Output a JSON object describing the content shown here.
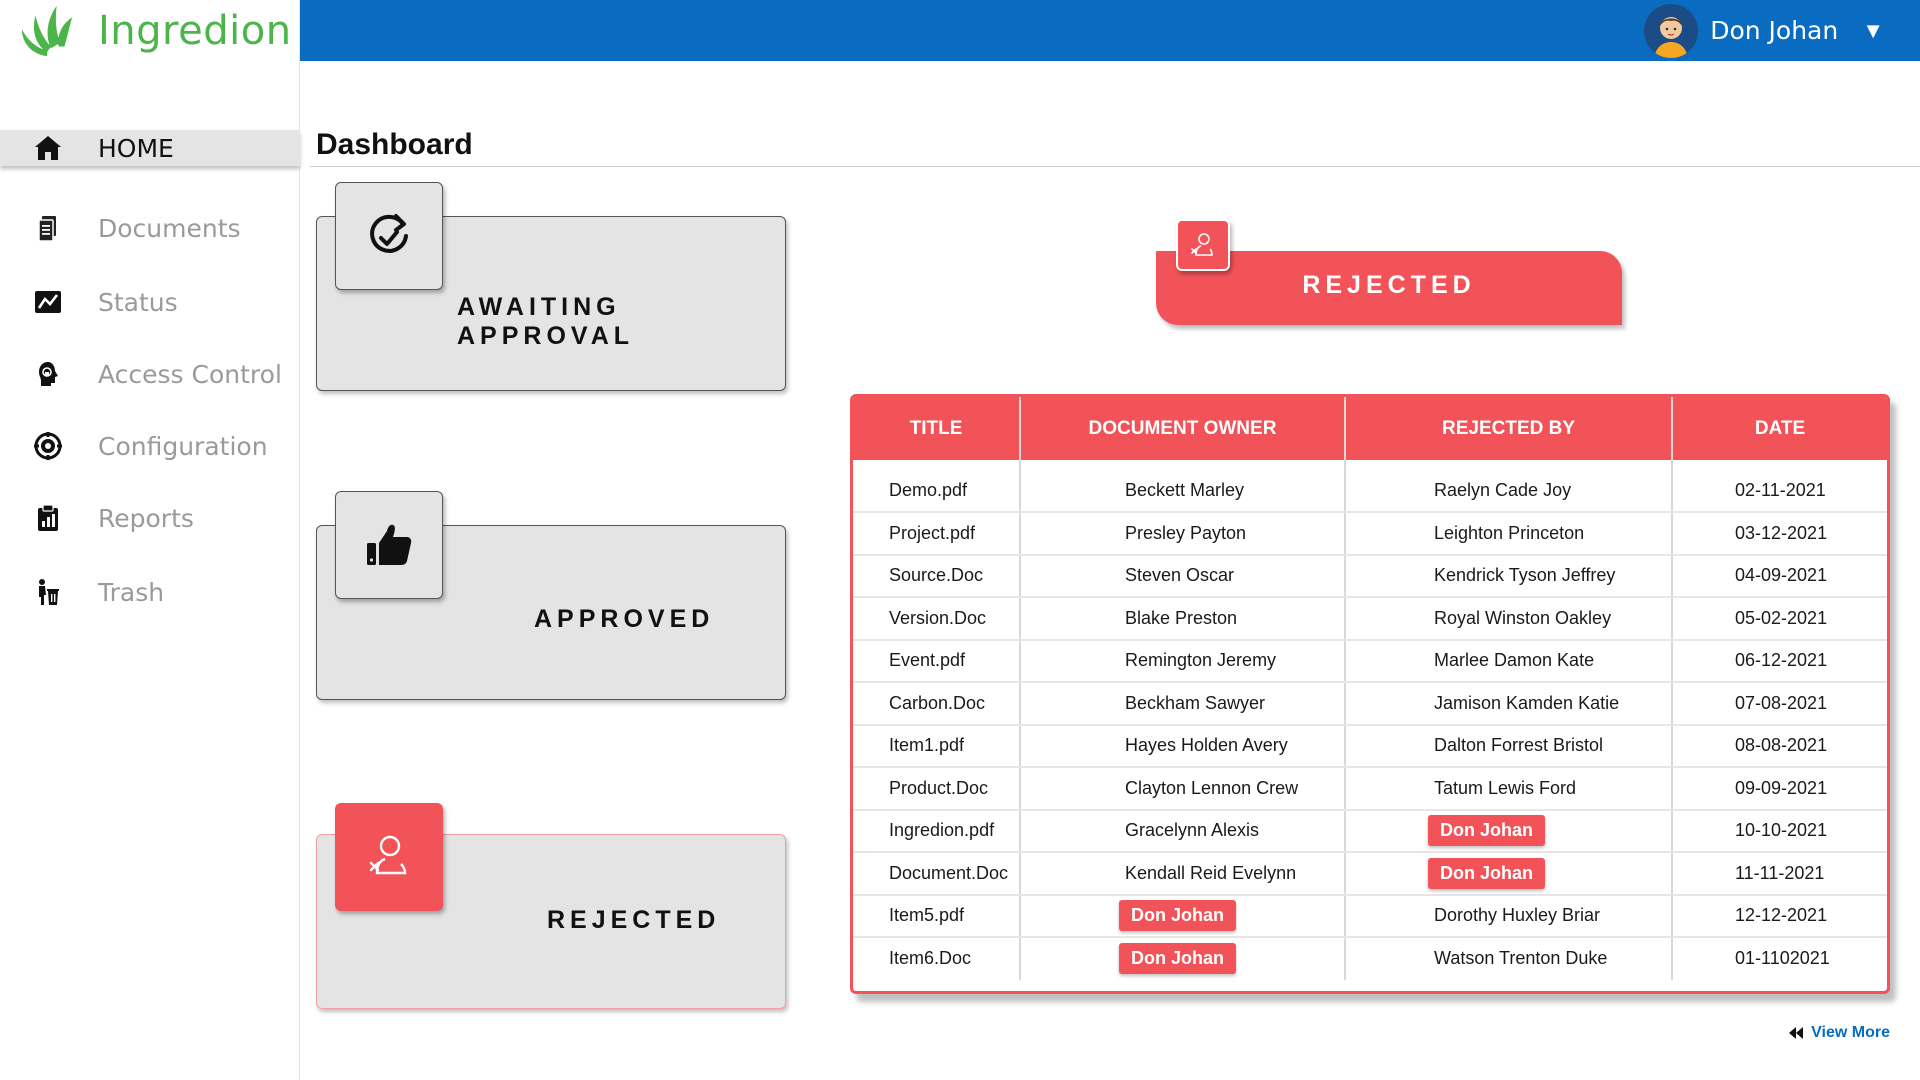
{
  "brand": {
    "name": "Ingredion",
    "color": "#4bb54a"
  },
  "colors": {
    "topbar": "#0a6cc1",
    "accent": "#f25358",
    "card": "#e4e4e4"
  },
  "user": {
    "name": "Don Johan",
    "caret": "▼"
  },
  "sidebar": {
    "items": [
      {
        "label": "HOME",
        "icon": "home-icon",
        "active": true
      },
      {
        "label": "Documents",
        "icon": "documents-icon"
      },
      {
        "label": "Status",
        "icon": "status-chart-icon"
      },
      {
        "label": "Access Control",
        "icon": "access-control-icon"
      },
      {
        "label": "Configuration",
        "icon": "configuration-icon"
      },
      {
        "label": "Reports",
        "icon": "reports-icon"
      },
      {
        "label": "Trash",
        "icon": "trash-icon"
      }
    ]
  },
  "page": {
    "title": "Dashboard"
  },
  "cards": {
    "awaiting": {
      "label": "AWAITING APPROVAL",
      "icon": "refresh-check-icon"
    },
    "approved": {
      "label": "APPROVED",
      "icon": "thumbs-up-icon"
    },
    "rejected": {
      "label": "REJECTED",
      "icon": "user-rejected-icon"
    }
  },
  "banner": {
    "label": "REJECTED",
    "icon": "user-rejected-icon"
  },
  "table": {
    "columns": [
      "TITLE",
      "DOCUMENT OWNER",
      "REJECTED BY",
      "DATE"
    ],
    "rows": [
      {
        "title": "Demo.pdf",
        "owner": "Beckett Marley",
        "rejected_by": "Raelyn Cade Joy",
        "date": "02-11-2021",
        "owner_highlight": false,
        "rejected_highlight": false
      },
      {
        "title": "Project.pdf",
        "owner": "Presley Payton",
        "rejected_by": "Leighton Princeton",
        "date": "03-12-2021",
        "owner_highlight": false,
        "rejected_highlight": false
      },
      {
        "title": "Source.Doc",
        "owner": "Steven Oscar",
        "rejected_by": "Kendrick Tyson Jeffrey",
        "date": "04-09-2021",
        "owner_highlight": false,
        "rejected_highlight": false
      },
      {
        "title": "Version.Doc",
        "owner": "Blake Preston",
        "rejected_by": "Royal Winston Oakley",
        "date": "05-02-2021",
        "owner_highlight": false,
        "rejected_highlight": false
      },
      {
        "title": "Event.pdf",
        "owner": "Remington Jeremy",
        "rejected_by": "Marlee Damon Kate",
        "date": "06-12-2021",
        "owner_highlight": false,
        "rejected_highlight": false
      },
      {
        "title": "Carbon.Doc",
        "owner": "Beckham Sawyer",
        "rejected_by": "Jamison Kamden Katie",
        "date": "07-08-2021",
        "owner_highlight": false,
        "rejected_highlight": false
      },
      {
        "title": "Item1.pdf",
        "owner": "Hayes Holden Avery",
        "rejected_by": "Dalton Forrest Bristol",
        "date": "08-08-2021",
        "owner_highlight": false,
        "rejected_highlight": false
      },
      {
        "title": "Product.Doc",
        "owner": "Clayton Lennon Crew",
        "rejected_by": "Tatum Lewis Ford",
        "date": "09-09-2021",
        "owner_highlight": false,
        "rejected_highlight": false
      },
      {
        "title": "Ingredion.pdf",
        "owner": "Gracelynn Alexis",
        "rejected_by": "Don Johan",
        "date": "10-10-2021",
        "owner_highlight": false,
        "rejected_highlight": true
      },
      {
        "title": "Document.Doc",
        "owner": "Kendall Reid Evelynn",
        "rejected_by": "Don Johan",
        "date": "11-11-2021",
        "owner_highlight": false,
        "rejected_highlight": true
      },
      {
        "title": "Item5.pdf",
        "owner": "Don Johan",
        "rejected_by": "Dorothy Huxley Briar",
        "date": "12-12-2021",
        "owner_highlight": true,
        "rejected_highlight": false
      },
      {
        "title": "Item6.Doc",
        "owner": "Don Johan",
        "rejected_by": "Watson Trenton Duke",
        "date": "01-1102021",
        "owner_highlight": true,
        "rejected_highlight": false
      }
    ]
  },
  "view_more": {
    "label": "View More",
    "icon": "rewind-icon"
  }
}
